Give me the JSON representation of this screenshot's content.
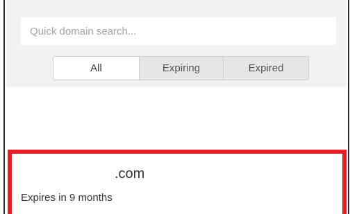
{
  "search": {
    "placeholder": "Quick domain search..."
  },
  "filter_tabs": [
    {
      "label": "All",
      "active": true
    },
    {
      "label": "Expiring",
      "active": false
    },
    {
      "label": "Expired",
      "active": false
    }
  ],
  "domains": [
    {
      "name": ".com",
      "expiry": "Expires in 9 months",
      "highlighted": true
    }
  ],
  "colors": {
    "highlight_border": "#e2202a",
    "top_area_bg": "#f2f2f2"
  }
}
